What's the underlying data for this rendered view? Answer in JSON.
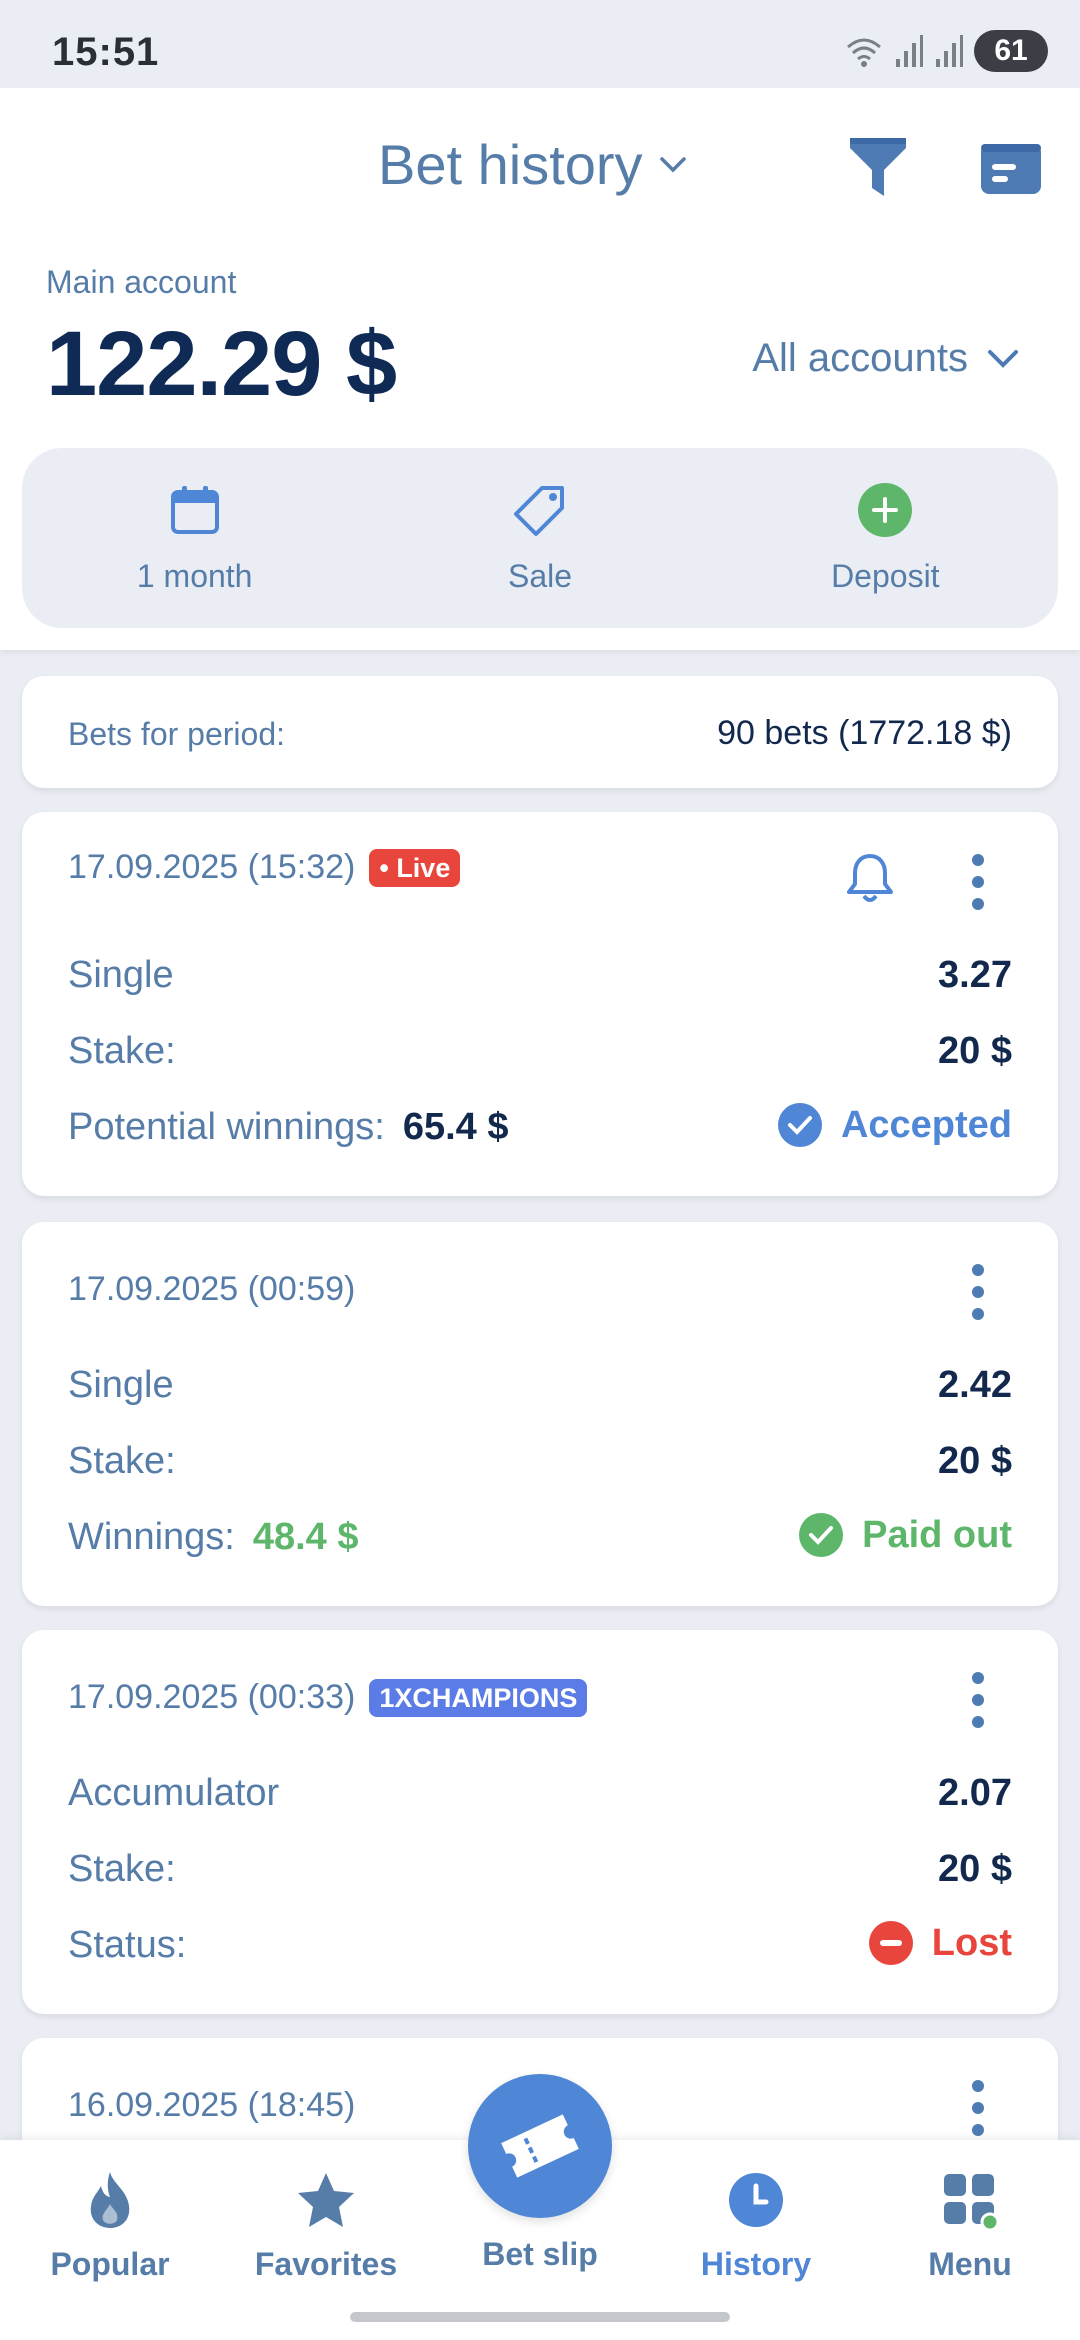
{
  "status_bar": {
    "time": "15:51",
    "battery": "61"
  },
  "header": {
    "title": "Bet history"
  },
  "account": {
    "label": "Main account",
    "balance": "122.29 $",
    "all_accounts": "All accounts"
  },
  "quick_actions": {
    "period": "1 month",
    "sale": "Sale",
    "deposit": "Deposit"
  },
  "period_summary": {
    "label": "Bets for period:",
    "value": "90 bets (1772.18 $)"
  },
  "bets": [
    {
      "date": "17.09.2025 (15:32)",
      "badge": "Live",
      "type": "Single",
      "coef": "3.27",
      "stake_label": "Stake:",
      "stake": "20 $",
      "result_label": "Potential winnings:",
      "result_value": "65.4 $",
      "status": "Accepted"
    },
    {
      "date": "17.09.2025 (00:59)",
      "type": "Single",
      "coef": "2.42",
      "stake_label": "Stake:",
      "stake": "20 $",
      "result_label": "Winnings:",
      "result_value": "48.4 $",
      "status": "Paid out"
    },
    {
      "date": "17.09.2025 (00:33)",
      "badge": "1XCHAMPIONS",
      "type": "Accumulator",
      "coef": "2.07",
      "stake_label": "Stake:",
      "stake": "20 $",
      "result_label": "Status:",
      "status": "Lost"
    },
    {
      "date": "16.09.2025 (18:45)"
    }
  ],
  "bottom_nav": {
    "popular": "Popular",
    "favorites": "Favorites",
    "bet_slip": "Bet slip",
    "history": "History",
    "menu": "Menu"
  },
  "colors": {
    "accent": "#4f86d6",
    "text_secondary": "#567ca8",
    "text_primary": "#12294d",
    "success": "#5db66a",
    "danger": "#e8463c",
    "background": "#eaeef4"
  }
}
